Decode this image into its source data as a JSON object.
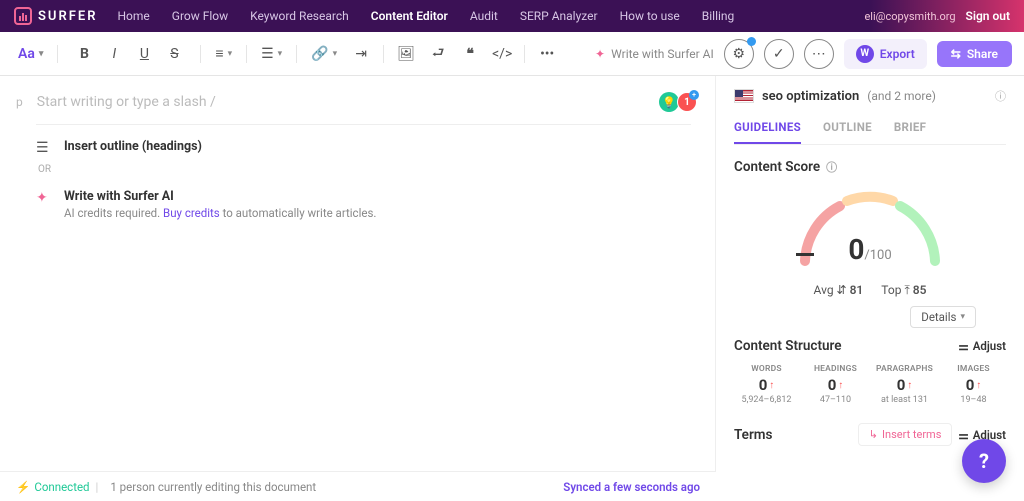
{
  "brand": "SURFER",
  "nav": {
    "items": [
      "Home",
      "Grow Flow",
      "Keyword Research",
      "Content Editor",
      "Audit",
      "SERP Analyzer",
      "How to use",
      "Billing"
    ],
    "active": 3
  },
  "user": {
    "email": "eli@copysmith.org",
    "signout": "Sign out"
  },
  "toolbar": {
    "aa": "Aa",
    "write_ai": "Write with Surfer AI",
    "export": "Export",
    "share": "Share"
  },
  "editor": {
    "p": "p",
    "placeholder": "Start writing or type a slash /",
    "badge_count": "1",
    "option1": {
      "title": "Insert outline (headings)"
    },
    "or": "OR",
    "option2": {
      "title": "Write with Surfer AI",
      "sub_before": "AI credits required. ",
      "link": "Buy credits",
      "sub_after": " to automatically write articles."
    }
  },
  "panel": {
    "keyword": "seo optimization",
    "more": "(and 2 more)",
    "tabs": [
      "GUIDELINES",
      "OUTLINE",
      "BRIEF"
    ],
    "score_title": "Content Score",
    "score": "0",
    "score_max": "/100",
    "avg_label": "Avg",
    "avg_val": "81",
    "top_label": "Top",
    "top_val": "85",
    "details": "Details",
    "structure_title": "Content Structure",
    "adjust": "Adjust",
    "metrics": [
      {
        "label": "WORDS",
        "val": "0",
        "range": "5,924–6,812"
      },
      {
        "label": "HEADINGS",
        "val": "0",
        "range": "47–110"
      },
      {
        "label": "PARAGRAPHS",
        "val": "0",
        "range": "at least 131"
      },
      {
        "label": "IMAGES",
        "val": "0",
        "range": "19–48"
      }
    ],
    "terms_title": "Terms",
    "insert_terms": "Insert terms"
  },
  "footer": {
    "connected": "Connected",
    "editing": "1 person currently editing this document",
    "synced": "Synced a few seconds ago"
  },
  "help": "?"
}
